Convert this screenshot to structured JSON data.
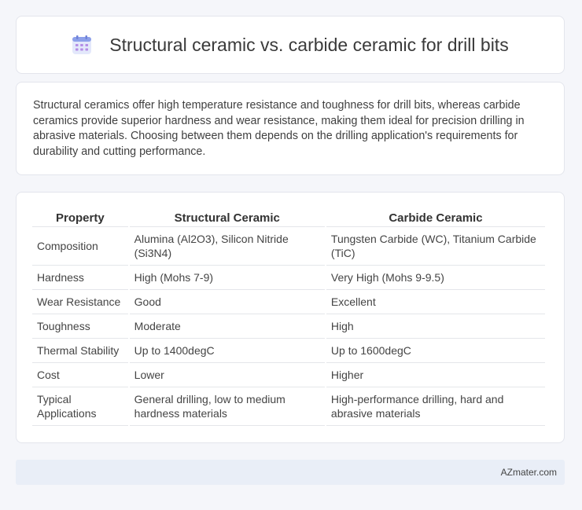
{
  "header": {
    "title": "Structural ceramic vs. carbide ceramic for drill bits",
    "icon": "calendar-grid-icon"
  },
  "intro": {
    "text": "Structural ceramics offer high temperature resistance and toughness for drill bits, whereas carbide ceramics provide superior hardness and wear resistance, making them ideal for precision drilling in abrasive materials. Choosing between them depends on the drilling application's requirements for durability and cutting performance."
  },
  "table": {
    "headers": [
      "Property",
      "Structural Ceramic",
      "Carbide Ceramic"
    ],
    "rows": [
      [
        "Composition",
        "Alumina (Al2O3), Silicon Nitride (Si3N4)",
        "Tungsten Carbide (WC), Titanium Carbide (TiC)"
      ],
      [
        "Hardness",
        "High (Mohs 7-9)",
        "Very High (Mohs 9-9.5)"
      ],
      [
        "Wear Resistance",
        "Good",
        "Excellent"
      ],
      [
        "Toughness",
        "Moderate",
        "High"
      ],
      [
        "Thermal Stability",
        "Up to 1400degC",
        "Up to 1600degC"
      ],
      [
        "Cost",
        "Lower",
        "Higher"
      ],
      [
        "Typical Applications",
        "General drilling, low to medium hardness materials",
        "High-performance drilling, hard and abrasive materials"
      ]
    ]
  },
  "footer": {
    "text": "AZmater.com"
  },
  "colors": {
    "background": "#f5f6fa",
    "card": "#ffffff",
    "footer": "#e9eef7",
    "icon_accent": "#7b8fe0"
  }
}
